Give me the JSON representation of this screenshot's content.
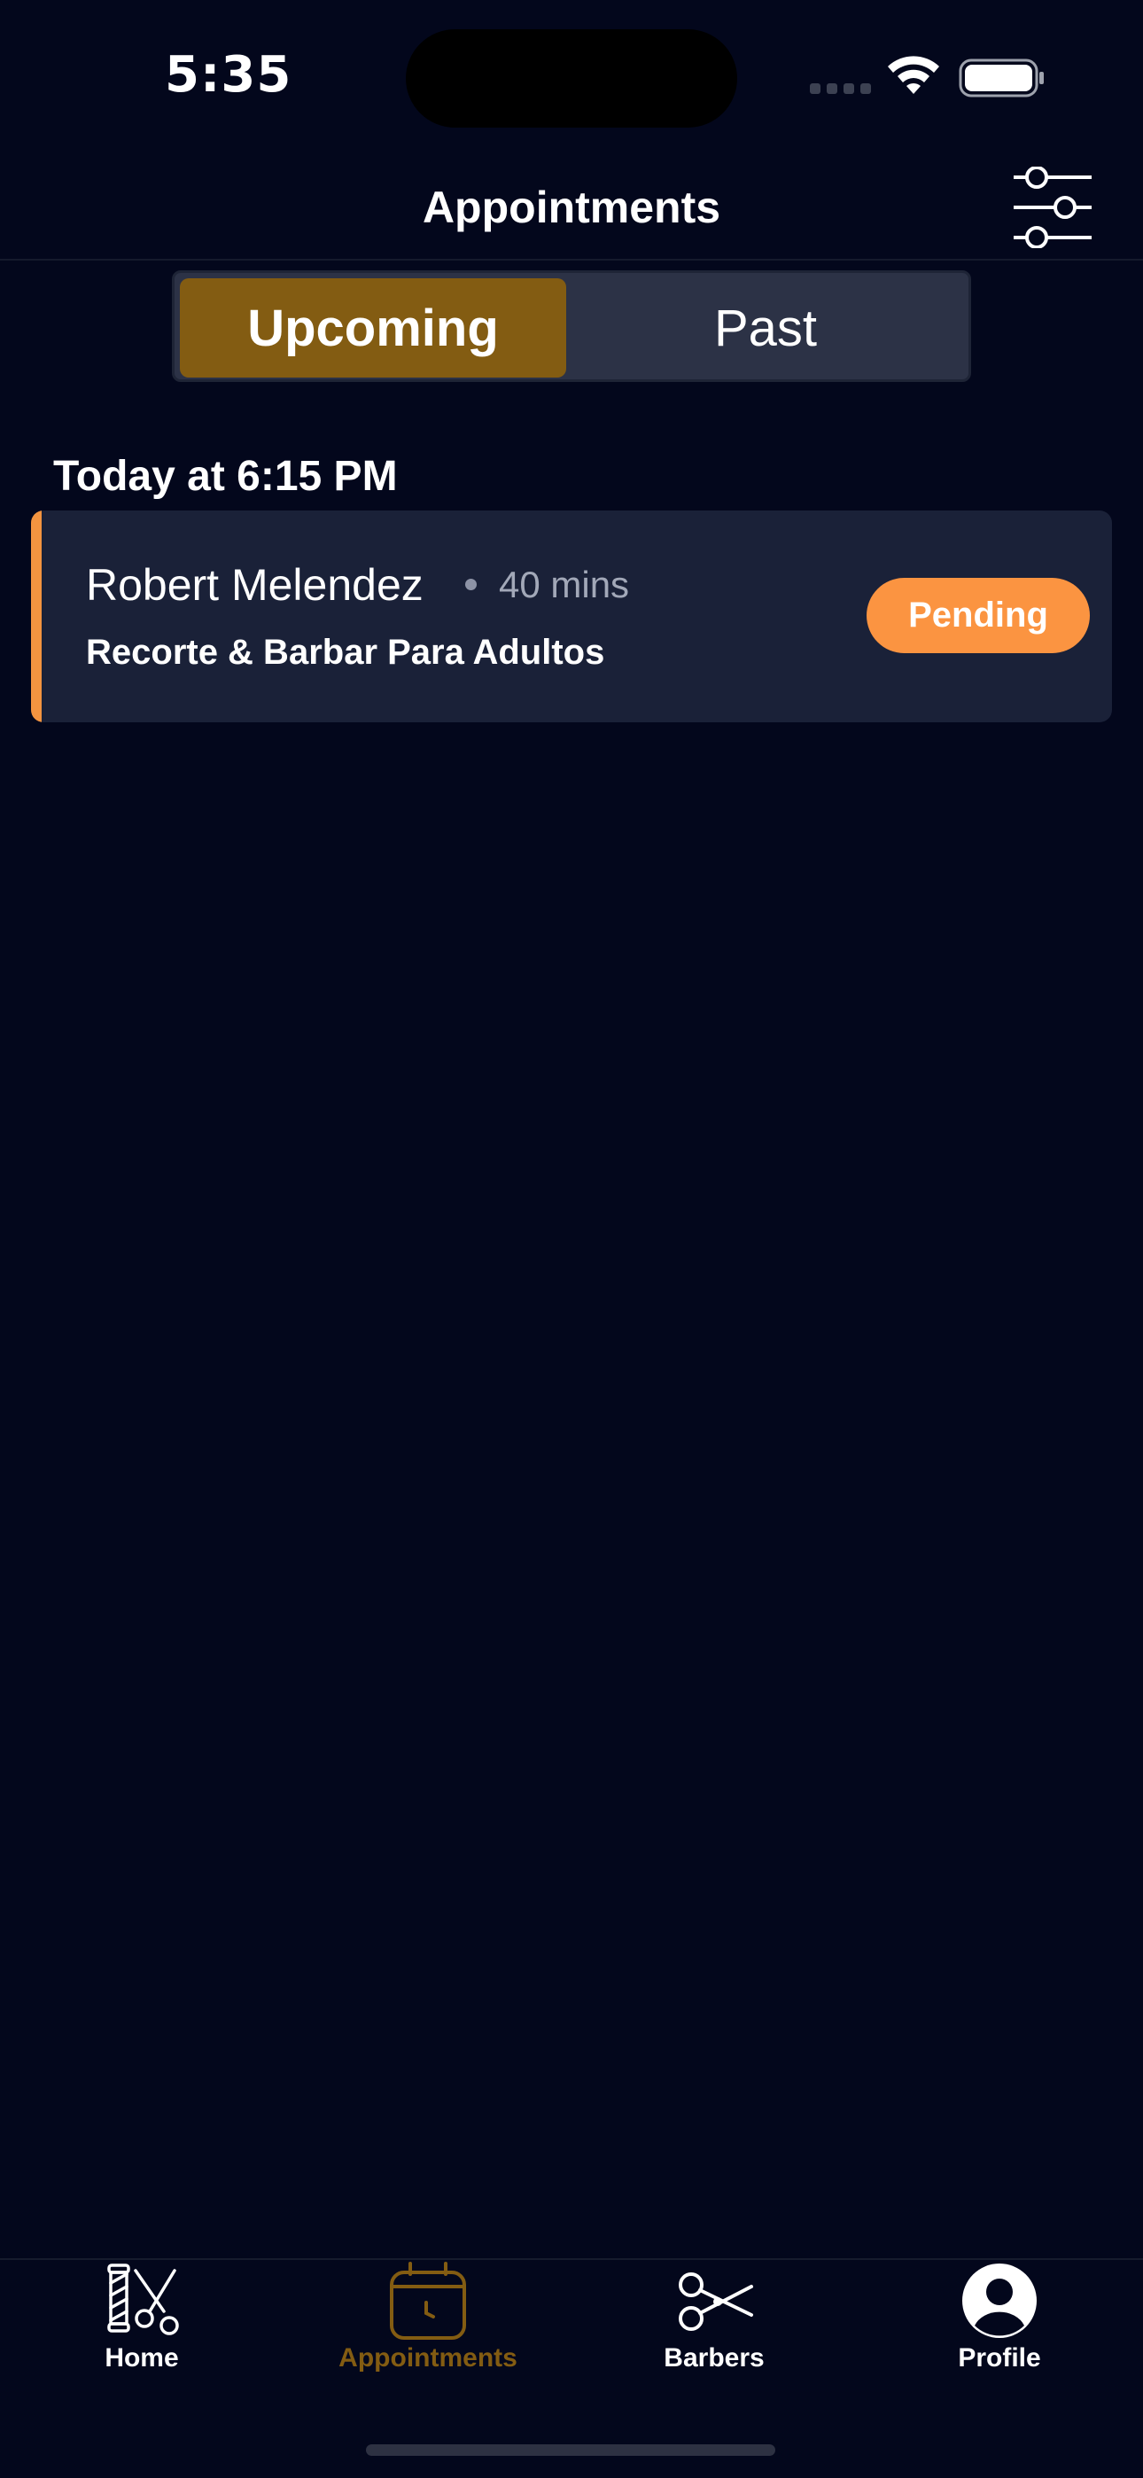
{
  "status_bar": {
    "time": "5:35"
  },
  "header": {
    "title": "Appointments",
    "filter_icon": "sliders-icon"
  },
  "segments": {
    "upcoming": "Upcoming",
    "past": "Past",
    "selected": "Upcoming"
  },
  "section": {
    "heading": "Today at 6:15 PM"
  },
  "appointment": {
    "client": "Robert Melendez",
    "duration": "40 mins",
    "service": "Recorte & Barbar Para Adultos",
    "status": "Pending"
  },
  "tabbar": {
    "home": "Home",
    "appointments": "Appointments",
    "barbers": "Barbers",
    "profile": "Profile",
    "active": "Appointments"
  },
  "colors": {
    "background": "#03071c",
    "accent_gold": "#835c12",
    "pending_orange": "#fb9441",
    "card": "#1a2138"
  }
}
